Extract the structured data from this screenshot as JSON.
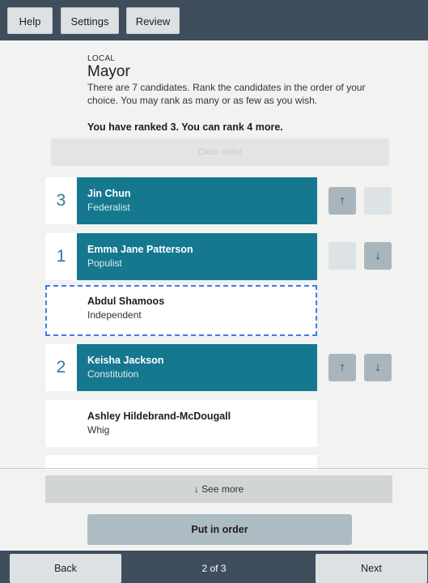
{
  "topbar": {
    "help_label": "Help",
    "settings_label": "Settings",
    "review_label": "Review"
  },
  "contest": {
    "category": "LOCAL",
    "title": "Mayor",
    "instructions": "There are 7 candidates. Rank the candidates in the order of your choice. You may rank as many or as few as you wish.",
    "status": "You have ranked 3. You can rank 4 more.",
    "clear_label": "Clear order"
  },
  "candidates": [
    {
      "rank": "3",
      "name": "Jin Chun",
      "party": "Federalist"
    },
    {
      "rank": "1",
      "name": "Emma Jane Patterson",
      "party": "Populist"
    },
    {
      "rank": "",
      "name": "Abdul Shamoos",
      "party": "Independent"
    },
    {
      "rank": "2",
      "name": "Keisha Jackson",
      "party": "Constitution"
    },
    {
      "rank": "",
      "name": "Ashley Hildebrand-McDougall",
      "party": "Whig"
    }
  ],
  "icons": {
    "up": "arrow-up-icon",
    "down": "arrow-down-icon"
  },
  "actions": {
    "see_more_label": "↓ See more",
    "put_in_order_label": "Put in order"
  },
  "bottombar": {
    "back_label": "Back",
    "page_indicator": "2 of 3",
    "next_label": "Next"
  },
  "colors": {
    "bar": "#3e4e5c",
    "ranked": "#15788f",
    "focus": "#3d7ee6"
  }
}
